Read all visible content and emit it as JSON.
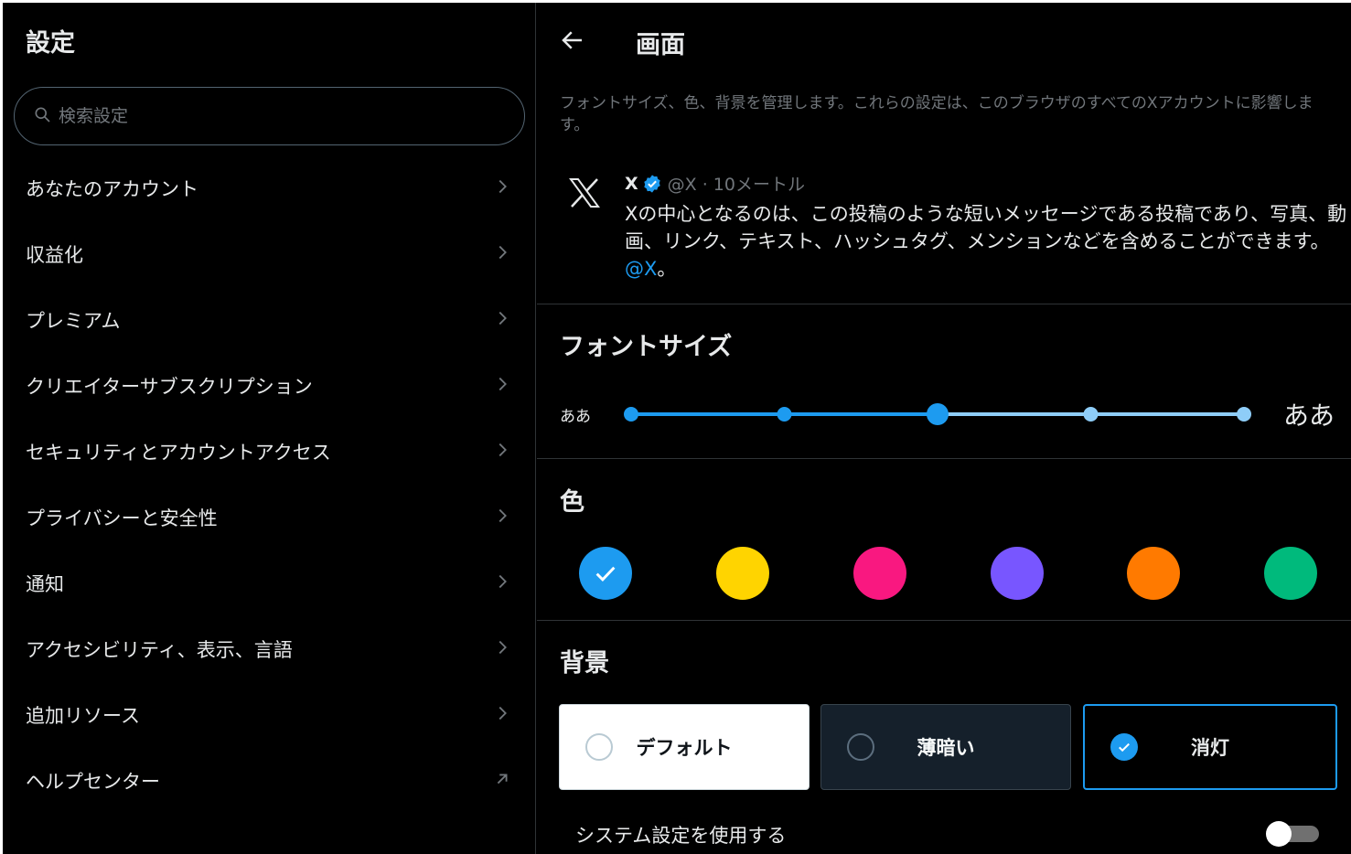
{
  "sidebar": {
    "title": "設定",
    "search_placeholder": "検索設定",
    "items": [
      {
        "label": "あなたのアカウント",
        "icon": "chevron-right-icon"
      },
      {
        "label": "収益化",
        "icon": "chevron-right-icon"
      },
      {
        "label": "プレミアム",
        "icon": "chevron-right-icon"
      },
      {
        "label": "クリエイターサブスクリプション",
        "icon": "chevron-right-icon"
      },
      {
        "label": "セキュリティとアカウントアクセス",
        "icon": "chevron-right-icon"
      },
      {
        "label": "プライバシーと安全性",
        "icon": "chevron-right-icon"
      },
      {
        "label": "通知",
        "icon": "chevron-right-icon"
      },
      {
        "label": "アクセシビリティ、表示、言語",
        "icon": "chevron-right-icon"
      },
      {
        "label": "追加リソース",
        "icon": "chevron-right-icon"
      },
      {
        "label": "ヘルプセンター",
        "icon": "external-link-icon"
      }
    ]
  },
  "display": {
    "title": "画面",
    "description": "フォントサイズ、色、背景を管理します。これらの設定は、このブラウザのすべてのXアカウントに影響します。",
    "post": {
      "name": "X",
      "handle_meta": "@X · 10メートル",
      "text": "Xの中心となるのは、この投稿のような短いメッセージである投稿であり、写真、動画、リンク、テキスト、ハッシュタグ、メンションなどを含めることができます。",
      "mention": "@X",
      "text_end": "。"
    },
    "font_size": {
      "title": "フォントサイズ",
      "small_label": "ああ",
      "large_label": "ああ",
      "steps": 5,
      "selected_index": 2
    },
    "color": {
      "title": "色",
      "swatches": [
        "#1d9bf0",
        "#ffd400",
        "#f91880",
        "#7856ff",
        "#ff7a00",
        "#00ba7c"
      ],
      "selected_index": 0
    },
    "background": {
      "title": "背景",
      "options": [
        {
          "label": "デフォルト",
          "selected": false
        },
        {
          "label": "薄暗い",
          "selected": false
        },
        {
          "label": "消灯",
          "selected": true
        }
      ]
    },
    "system": {
      "label": "システム設定を使用する",
      "enabled": false
    }
  },
  "colors": {
    "accent": "#1d9bf0",
    "text_primary": "#e7e9ea",
    "text_secondary": "#71767b",
    "border": "#2f3336"
  }
}
